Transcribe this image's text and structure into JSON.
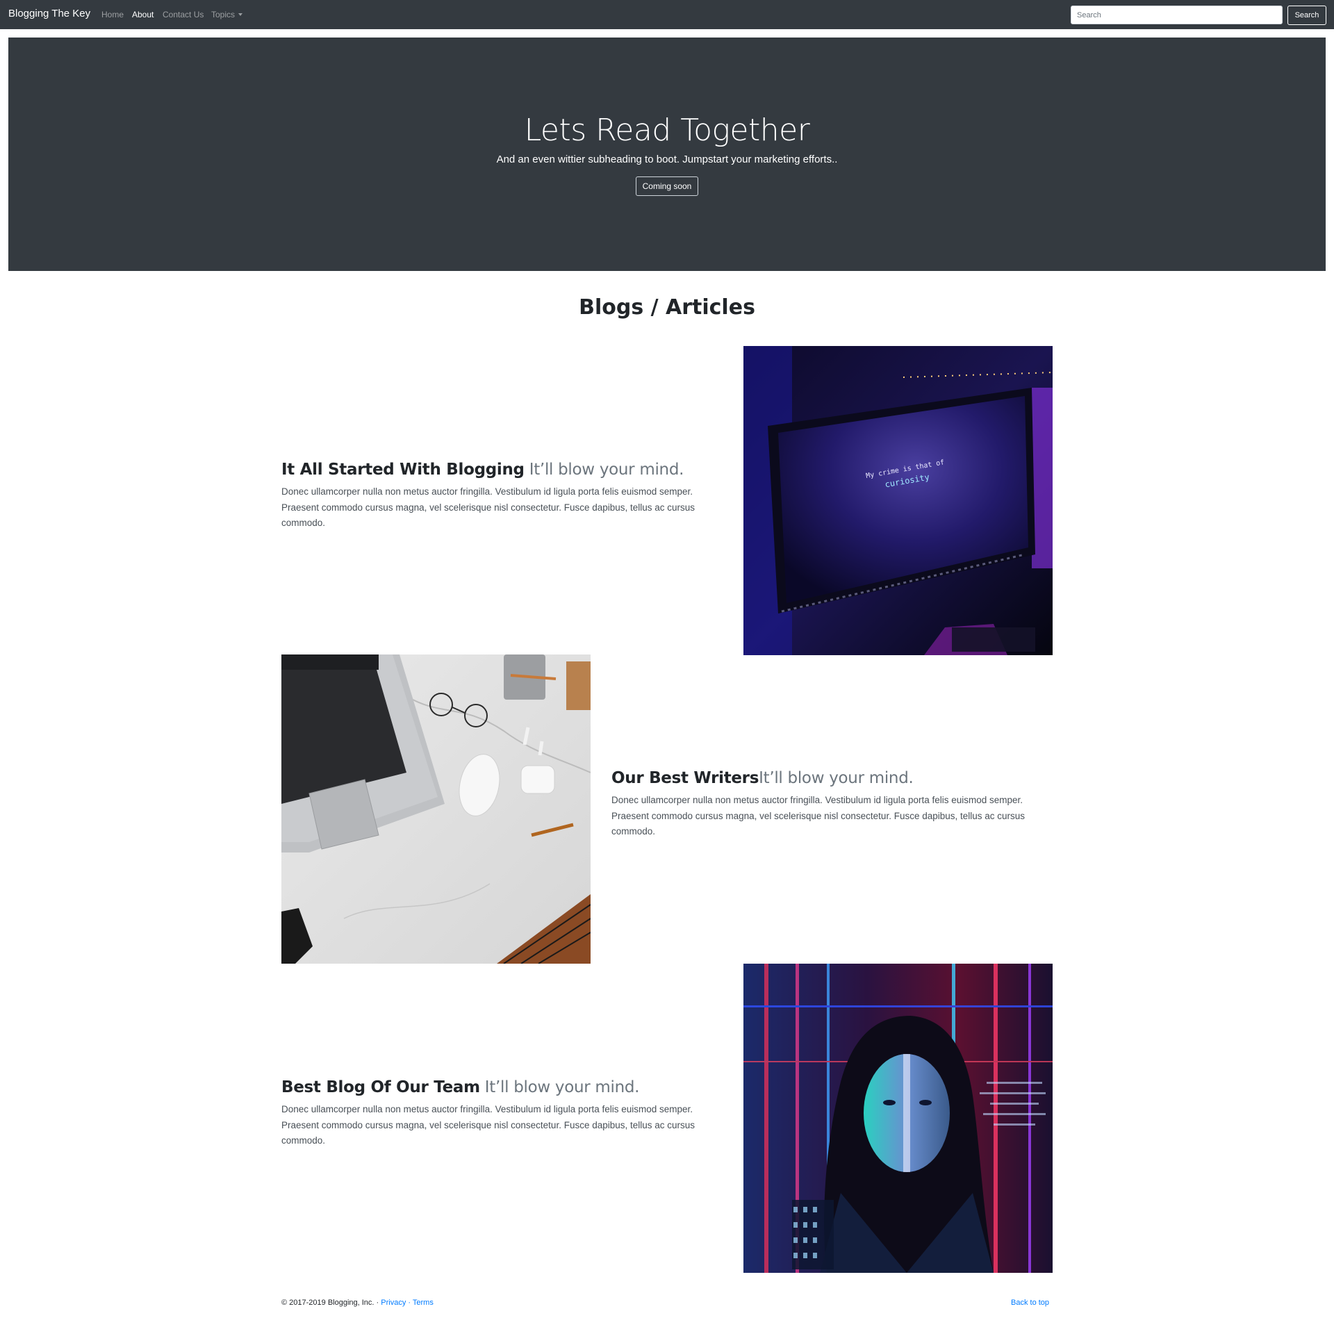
{
  "navbar": {
    "brand": "Blogging The Key",
    "links": [
      "Home",
      "About",
      "Contact Us",
      "Topics"
    ],
    "search_placeholder": "Search",
    "search_button": "Search"
  },
  "hero": {
    "title": "Lets Read Together",
    "subtitle": "And an even wittier subheading to boot. Jumpstart your marketing efforts..",
    "button": "Coming soon"
  },
  "section_title": "Blogs / Articles",
  "featurettes": [
    {
      "heading": "It All Started With Blogging",
      "heading_muted": " It’ll blow your mind.",
      "text": "Donec ullamcorper nulla non metus auctor fringilla. Vestibulum id ligula porta felis euismod semper. Praesent commodo cursus magna, vel scelerisque nisl consectetur. Fusce dapibus, tellus ac cursus commodo.",
      "image_text_line1": "My crime is that of",
      "image_text_line2": "curiosity"
    },
    {
      "heading": "Our Best Writers",
      "heading_muted": "It’ll blow your mind.",
      "text": "Donec ullamcorper nulla non metus auctor fringilla. Vestibulum id ligula porta felis euismod semper. Praesent commodo cursus magna, vel scelerisque nisl consectetur. Fusce dapibus, tellus ac cursus commodo."
    },
    {
      "heading": "Best Blog Of Our Team",
      "heading_muted": " It’ll blow your mind.",
      "text": "Donec ullamcorper nulla non metus auctor fringilla. Vestibulum id ligula porta felis euismod semper. Praesent commodo cursus magna, vel scelerisque nisl consectetur. Fusce dapibus, tellus ac cursus commodo."
    }
  ],
  "footer": {
    "copyright": "© 2017-2019 Blogging, Inc. · ",
    "privacy": "Privacy",
    "separator": " · ",
    "terms": "Terms",
    "back_to_top": "Back to top"
  },
  "colors": {
    "navbar_bg": "#343a40",
    "hero_bg": "#343a40",
    "link": "#007bff",
    "muted": "#6c757d"
  }
}
